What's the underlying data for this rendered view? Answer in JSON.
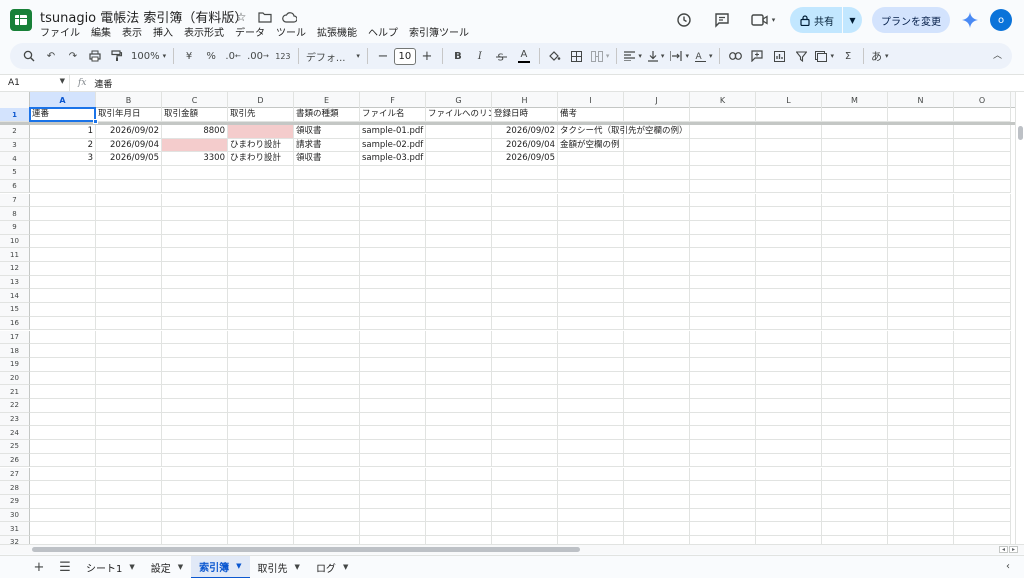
{
  "app": {
    "doc_title": "tsunagio 電帳法 索引簿（有料版）",
    "menu": [
      "ファイル",
      "編集",
      "表示",
      "挿入",
      "表示形式",
      "データ",
      "ツール",
      "拡張機能",
      "ヘルプ",
      "索引簿ツール"
    ],
    "share_label": "共有",
    "plan_label": "プランを変更",
    "avatar_letter": "o"
  },
  "toolbar": {
    "zoom": "100%",
    "currency": "¥",
    "percent": "%",
    "dec_decrease": ".0",
    "dec_increase": ".00",
    "num_format": "123",
    "font": "デフォ...",
    "font_size": "10",
    "bold": "B",
    "italic": "I",
    "text_color": "A",
    "sigma": "Σ",
    "input_mode": "あ"
  },
  "formula_bar": {
    "name_box": "A1",
    "fx": "fx",
    "value": "連番"
  },
  "grid": {
    "columns": [
      "A",
      "B",
      "C",
      "D",
      "E",
      "F",
      "G",
      "H",
      "I",
      "J",
      "K",
      "L",
      "M",
      "N",
      "O"
    ],
    "row_numbers": [
      "1",
      "2",
      "3",
      "4",
      "5",
      "6",
      "7",
      "8",
      "9",
      "10",
      "11",
      "12",
      "13",
      "14",
      "15",
      "16",
      "17",
      "18",
      "19",
      "20",
      "21",
      "22",
      "23",
      "24",
      "25",
      "26",
      "27",
      "28",
      "29",
      "30",
      "31",
      "32"
    ],
    "header": [
      "連番",
      "取引年月日",
      "取引金額",
      "取引先",
      "書類の種類",
      "ファイル名",
      "ファイルへのリンク",
      "登録日時",
      "備考"
    ],
    "rows": [
      [
        "1",
        "2026/09/02",
        "8800",
        "",
        "領収書",
        "sample-01.pdf",
        "",
        "2026/09/02",
        "タクシー代（取引先が空欄の例）"
      ],
      [
        "2",
        "2026/09/04",
        "",
        "ひまわり設計",
        "請求書",
        "sample-02.pdf",
        "",
        "2026/09/04",
        "金額が空欄の例"
      ],
      [
        "3",
        "2026/09/05",
        "3300",
        "ひまわり設計",
        "領収書",
        "sample-03.pdf",
        "",
        "2026/09/05",
        ""
      ]
    ],
    "highlight_color": "#f4cccc",
    "selection_color": "#1a73e8"
  },
  "sheet_tabs": {
    "tabs": [
      "シート1",
      "設定",
      "索引簿",
      "取引先",
      "ログ"
    ],
    "active": "索引簿"
  }
}
